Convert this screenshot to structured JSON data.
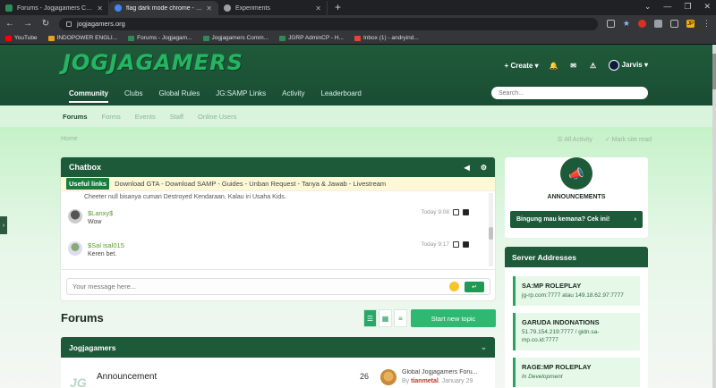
{
  "browser": {
    "tabs": [
      {
        "title": "Forums - Jogjagamers Community",
        "active": false
      },
      {
        "title": "flag dark mode chrome - Google",
        "active": true
      },
      {
        "title": "Experiments",
        "active": false
      }
    ],
    "url": "jogjagamers.org",
    "bookmarks": [
      {
        "label": "YouTube"
      },
      {
        "label": "INDOPOWER ENGLI..."
      },
      {
        "label": "Forums - Jogjagam..."
      },
      {
        "label": "Jogjagamers Comm..."
      },
      {
        "label": "JGRP AdminCP - H..."
      },
      {
        "label": "Inbox (1) - andryind..."
      }
    ],
    "profile_initial": "JP"
  },
  "site": {
    "logo_text": "JOGJAGAMERS",
    "create_label": "Create",
    "user_name": "Jarvis",
    "nav": [
      {
        "label": "Community",
        "active": true
      },
      {
        "label": "Clubs",
        "active": false
      },
      {
        "label": "Global Rules",
        "active": false
      },
      {
        "label": "JG:SAMP Links",
        "active": false
      },
      {
        "label": "Activity",
        "active": false
      },
      {
        "label": "Leaderboard",
        "active": false
      }
    ],
    "search_placeholder": "Search...",
    "subnav": [
      {
        "label": "Forums",
        "active": true
      },
      {
        "label": "Forms",
        "active": false
      },
      {
        "label": "Events",
        "active": false
      },
      {
        "label": "Staff",
        "active": false
      },
      {
        "label": "Online Users",
        "active": false
      }
    ],
    "breadcrumb": "Home",
    "all_activity": "All Activity",
    "mark_read": "Mark site read"
  },
  "chatbox": {
    "title": "Chatbox",
    "useful_label": "Useful links",
    "useful_text": "Download GTA - Download SAMP - Guides - Unban Request - Tanya & Jawab - Livestream",
    "prev_text": "Cheeter null bisanya cuman Destroyed Kendaraan, Kalau iri Usaha Kids.",
    "messages": [
      {
        "name": "$Lanxy$",
        "text": "Wow",
        "time": "Today 9:08"
      },
      {
        "name": "$Sal isal015",
        "text": "Keren bet.",
        "time": "Today 9:17"
      }
    ],
    "input_placeholder": "Your message here..."
  },
  "forums": {
    "title": "Forums",
    "start_topic": "Start new topic",
    "category": "Jogjagamers",
    "rows": [
      {
        "title": "Announcement",
        "count": "26",
        "last_title": "Global Jogjagamers Foru...",
        "last_by_prefix": "By",
        "last_by": "tianmetal",
        "last_date": "January 29"
      }
    ]
  },
  "sidebar": {
    "announcements_title": "ANNOUNCEMENTS",
    "announcement_button": "Bingung mau kemana? Cek ini!",
    "server_title": "Server Addresses",
    "servers": [
      {
        "name": "SA:MP ROLEPLAY",
        "addr": "jg-rp.com:7777 atau 149.18.62.97:7777"
      },
      {
        "name": "GARUDA INDONATIONS",
        "addr": "51.79.154.219:7777 / gidn.sa-mp.co.id:7777"
      },
      {
        "name": "RAGE:MP ROLEPLAY",
        "addr": "In Development"
      }
    ]
  }
}
